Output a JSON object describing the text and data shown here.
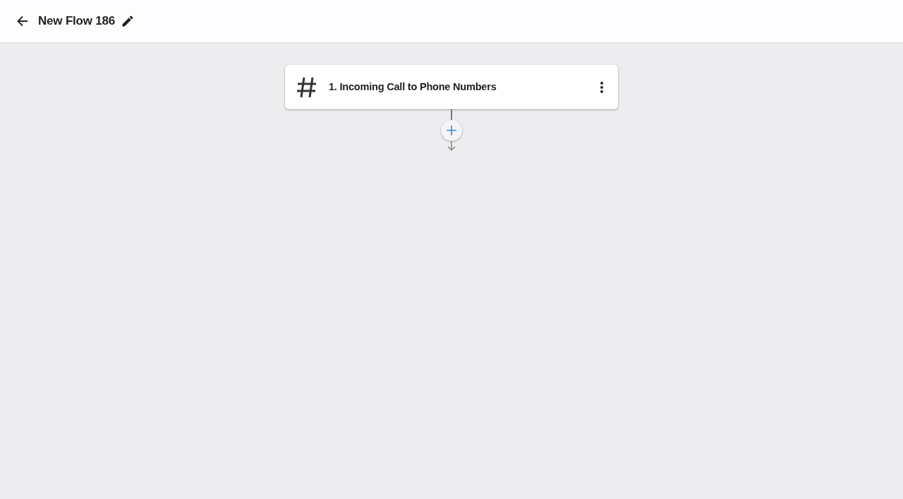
{
  "header": {
    "title": "New Flow 186"
  },
  "flow": {
    "steps": [
      {
        "label": "1. Incoming Call to Phone Numbers"
      }
    ]
  }
}
